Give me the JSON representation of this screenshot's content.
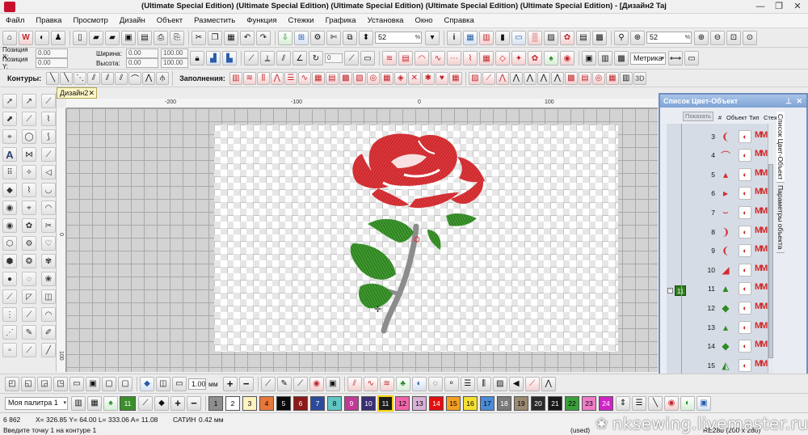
{
  "window": {
    "title": "(Ultimate Special Edition) (Ultimate Special Edition) (Ultimate Special Edition) (Ultimate Special Edition) (Ultimate Special Edition) - [Дизайн2",
    "app_name": "Taj",
    "minimize": "—",
    "maximize": "❐",
    "close": "✕"
  },
  "menu": [
    "Файл",
    "Правка",
    "Просмотр",
    "Дизайн",
    "Объект",
    "Разместить",
    "Функция",
    "Стежки",
    "Графика",
    "Установка",
    "Окно",
    "Справка"
  ],
  "toolbar1": {
    "zoom_value": "52",
    "zoom_unit": "%",
    "zoom2_value": "52",
    "zoom2_unit": "%"
  },
  "toolbar2": {
    "pos_x_label": "Позиция X:",
    "pos_x": "0.00",
    "pos_y_label": "Позиция Y:",
    "pos_y": "0.00",
    "width_label": "Ширина:",
    "width": "0.00",
    "height_label": "Высота:",
    "height": "0.00",
    "scale1": "100.00",
    "scale2": "100.00",
    "rot": "0",
    "units": "Метрика"
  },
  "toolbar3": {
    "contours_label": "Контуры:",
    "fills_label": "Заполнения:",
    "view3d": "3D"
  },
  "doc_tab": {
    "label": "Дизайн2",
    "close": "✕"
  },
  "rulers": {
    "top": [
      "-200",
      "-100",
      "0",
      "100"
    ],
    "left": [
      "0",
      "100"
    ]
  },
  "panel": {
    "title": "Список Цвет-Объект",
    "show_button": "Показать",
    "col_num": "#",
    "col_obj": "Объект",
    "col_type": "Тип",
    "col_stitch": "Стежк",
    "color_block": "11",
    "rows": [
      {
        "num": "3",
        "glyph": "❨"
      },
      {
        "num": "4",
        "glyph": "⌒"
      },
      {
        "num": "5",
        "glyph": "▴"
      },
      {
        "num": "6",
        "glyph": "▸"
      },
      {
        "num": "7",
        "glyph": "⌣"
      },
      {
        "num": "8",
        "glyph": "❩"
      },
      {
        "num": "9",
        "glyph": "❨"
      },
      {
        "num": "10",
        "glyph": "◢"
      },
      {
        "num": "11",
        "glyph": "▲"
      },
      {
        "num": "12",
        "glyph": "◆"
      },
      {
        "num": "13",
        "glyph": "▴"
      },
      {
        "num": "14",
        "glyph": "◆"
      },
      {
        "num": "15",
        "glyph": "◭"
      }
    ],
    "side_tabs": [
      "Список Цвет-Объект",
      "Параметры объекта"
    ]
  },
  "bottom_toolbar": {
    "size_value": "1.00",
    "size_unit": "мм"
  },
  "palette": {
    "name": "Моя палитра 1",
    "current": "11",
    "swatches": [
      {
        "n": "1",
        "c": "#8e8e8e",
        "t": "#000"
      },
      {
        "n": "2",
        "c": "#ffffff",
        "t": "#000"
      },
      {
        "n": "3",
        "c": "#fff3c0",
        "t": "#000"
      },
      {
        "n": "4",
        "c": "#e8783a",
        "t": "#000"
      },
      {
        "n": "5",
        "c": "#0a0a0a",
        "t": "#fff"
      },
      {
        "n": "6",
        "c": "#8b1a1a",
        "t": "#fff"
      },
      {
        "n": "7",
        "c": "#2b4a9b",
        "t": "#fff"
      },
      {
        "n": "8",
        "c": "#5fc6c4",
        "t": "#000"
      },
      {
        "n": "9",
        "c": "#c23a96",
        "t": "#fff"
      },
      {
        "n": "10",
        "c": "#3a2e74",
        "t": "#fff"
      },
      {
        "n": "11",
        "c": "#1c1c1c",
        "t": "#fff"
      },
      {
        "n": "12",
        "c": "#f064a8",
        "t": "#000"
      },
      {
        "n": "13",
        "c": "#d8b0d8",
        "t": "#000"
      },
      {
        "n": "14",
        "c": "#e01010",
        "t": "#fff"
      },
      {
        "n": "15",
        "c": "#f4a020",
        "t": "#000"
      },
      {
        "n": "16",
        "c": "#f4e030",
        "t": "#000"
      },
      {
        "n": "17",
        "c": "#4a8ad8",
        "t": "#000"
      },
      {
        "n": "18",
        "c": "#7a7a7a",
        "t": "#fff"
      },
      {
        "n": "19",
        "c": "#9a8a72",
        "t": "#000"
      },
      {
        "n": "20",
        "c": "#2a2a2a",
        "t": "#fff"
      },
      {
        "n": "21",
        "c": "#181818",
        "t": "#fff"
      },
      {
        "n": "22",
        "c": "#3aa03a",
        "t": "#000"
      },
      {
        "n": "23",
        "c": "#f07cc8",
        "t": "#000"
      },
      {
        "n": "24",
        "c": "#d024c8",
        "t": "#fff"
      }
    ]
  },
  "status": {
    "count": "6 862",
    "coords": "X= 326.85 Y= 64.00 L= 333.06 A= 11.08",
    "stitch_type": "САТИН",
    "stitch_len": "0.42 мм",
    "prompt": "Введите точку 1 на контуре 1",
    "used": "(used)",
    "hoop": "RE28b (200 x 280)"
  },
  "watermark": "nksewing.livemaster.ru",
  "colors": {
    "rose_red": "#e0363a",
    "leaf_green": "#3a8f2a",
    "stem_gray": "#8c8c8c",
    "panel_border": "#6f8fbf"
  }
}
